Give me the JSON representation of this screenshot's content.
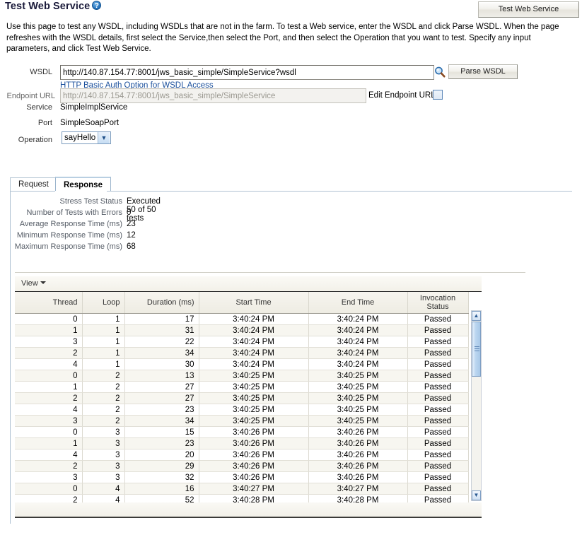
{
  "header": {
    "title": "Test Web Service",
    "help_icon": "help-question-icon",
    "help_glyph": "?",
    "test_button_label": "Test Web Service"
  },
  "intro": {
    "text": "Use this page to test any WSDL, including WSDLs that are not in the farm. To test a Web service, enter the WSDL and click Parse WSDL. When the page refreshes with the WSDL details, first select the Service,then select the Port, and then select the Operation that you want to test. Specify any input parameters, and click Test Web Service."
  },
  "form": {
    "wsdl_label": "WSDL",
    "wsdl_value": "http://140.87.154.77:8001/jws_basic_simple/SimpleService?wsdl",
    "wsdl_placeholder": "",
    "search_icon": "magnifier-search-icon",
    "parse_button_label": "Parse WSDL",
    "auth_link_label": "HTTP Basic Auth Option for WSDL Access",
    "service_label": "Service",
    "service_value": "SimpleImplService",
    "port_label": "Port",
    "port_value": "SimpleSoapPort",
    "operation_label": "Operation",
    "operation_value": "sayHello",
    "operation_options": [
      "sayHello"
    ],
    "endpoint_label": "Endpoint URL",
    "endpoint_value": "http://140.87.154.77:8001/jws_basic_simple/SimpleService",
    "edit_endpoint_label": "Edit Endpoint URL",
    "edit_endpoint_checked": "false"
  },
  "tabs": {
    "request_label": "Request",
    "response_label": "Response",
    "active": "Response"
  },
  "stats": {
    "rows": [
      {
        "label": "Stress Test Status",
        "value": "Executed 50 of 50 tests"
      },
      {
        "label": "Number of Tests with Errors",
        "value": "0"
      },
      {
        "label": "Average Response Time (ms)",
        "value": "23"
      },
      {
        "label": "Minimum Response Time (ms)",
        "value": "12"
      },
      {
        "label": "Maximum Response Time (ms)",
        "value": "68"
      }
    ]
  },
  "toolbar": {
    "view_label": "View",
    "view_caret_icon": "chevron-down-icon"
  },
  "table": {
    "columns": [
      "Thread",
      "Loop",
      "Duration (ms)",
      "Start Time",
      "End Time",
      "Invocation Status"
    ],
    "rows": [
      [
        "0",
        "1",
        "17",
        "3:40:24 PM",
        "3:40:24 PM",
        "Passed"
      ],
      [
        "1",
        "1",
        "31",
        "3:40:24 PM",
        "3:40:24 PM",
        "Passed"
      ],
      [
        "3",
        "1",
        "22",
        "3:40:24 PM",
        "3:40:24 PM",
        "Passed"
      ],
      [
        "2",
        "1",
        "34",
        "3:40:24 PM",
        "3:40:24 PM",
        "Passed"
      ],
      [
        "4",
        "1",
        "30",
        "3:40:24 PM",
        "3:40:24 PM",
        "Passed"
      ],
      [
        "0",
        "2",
        "13",
        "3:40:25 PM",
        "3:40:25 PM",
        "Passed"
      ],
      [
        "1",
        "2",
        "27",
        "3:40:25 PM",
        "3:40:25 PM",
        "Passed"
      ],
      [
        "2",
        "2",
        "27",
        "3:40:25 PM",
        "3:40:25 PM",
        "Passed"
      ],
      [
        "4",
        "2",
        "23",
        "3:40:25 PM",
        "3:40:25 PM",
        "Passed"
      ],
      [
        "3",
        "2",
        "34",
        "3:40:25 PM",
        "3:40:25 PM",
        "Passed"
      ],
      [
        "0",
        "3",
        "15",
        "3:40:26 PM",
        "3:40:26 PM",
        "Passed"
      ],
      [
        "1",
        "3",
        "23",
        "3:40:26 PM",
        "3:40:26 PM",
        "Passed"
      ],
      [
        "4",
        "3",
        "20",
        "3:40:26 PM",
        "3:40:26 PM",
        "Passed"
      ],
      [
        "2",
        "3",
        "29",
        "3:40:26 PM",
        "3:40:26 PM",
        "Passed"
      ],
      [
        "3",
        "3",
        "32",
        "3:40:26 PM",
        "3:40:26 PM",
        "Passed"
      ],
      [
        "0",
        "4",
        "16",
        "3:40:27 PM",
        "3:40:27 PM",
        "Passed"
      ],
      [
        "2",
        "4",
        "52",
        "3:40:28 PM",
        "3:40:28 PM",
        "Passed"
      ]
    ],
    "scroll_up_icon": "chevron-up-icon",
    "scroll_down_icon": "chevron-down-icon"
  },
  "colors": {
    "link": "#1a4f9c",
    "title": "#1a1a3a",
    "label": "#555c66"
  }
}
